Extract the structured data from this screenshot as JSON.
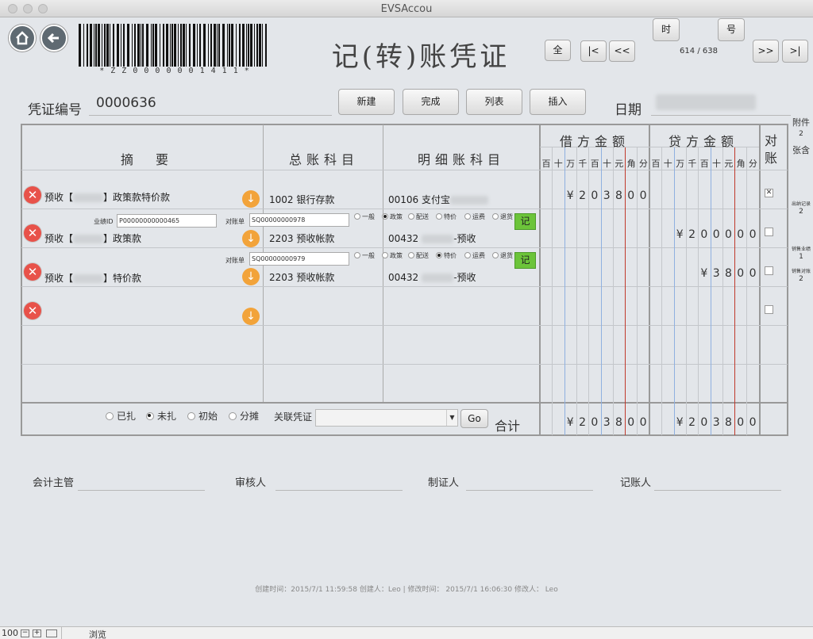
{
  "window": {
    "title": "EVSAccou"
  },
  "header": {
    "barcode_text": "* Z Z 0 0 0 0 0 0 1 4 1 1 *",
    "title": "记(转)账凭证",
    "btn_all": "全",
    "btn_first": "|<",
    "btn_prev": "<<",
    "btn_next": ">>",
    "btn_last": ">|",
    "btn_time": "时",
    "btn_number": "号",
    "record_counter": "614 / 638"
  },
  "voucher": {
    "number_label": "凭证编号",
    "number_value": "0000636",
    "date_label": "日期",
    "btn_new": "新建",
    "btn_done": "完成",
    "btn_list": "列表",
    "btn_insert": "插入"
  },
  "table": {
    "col_summary": "摘　要",
    "col_ledger": "总账科目",
    "col_detail": "明细账科目",
    "col_debit": "借方金额",
    "col_credit": "贷方金额",
    "col_reconcile": "对账",
    "digit_units": [
      "百",
      "十",
      "万",
      "千",
      "百",
      "十",
      "元",
      "角",
      "分"
    ],
    "rows": [
      {
        "summary_prefix": "预收【",
        "summary_suffix": "】政策款特价款",
        "ledger": "1002  银行存款",
        "detail_code": "00106  支付宝",
        "detail_suffix": "",
        "debit": "¥203800",
        "credit": "",
        "reconcile": "✕",
        "extra": {
          "perf_label": "业绩ID",
          "perf_value": "P00000000000465",
          "recon_label": "对账单",
          "recon_value": "SQ00000000978",
          "options": [
            "一般",
            "政策",
            "配送",
            "特价",
            "运费",
            "退货"
          ],
          "selected": 1,
          "btn": "记"
        }
      },
      {
        "summary_prefix": "预收【",
        "summary_suffix": "】政策款",
        "ledger": "2203  预收帐款",
        "detail_code": "00432",
        "detail_suffix": "-预收",
        "debit": "",
        "credit": "¥200000",
        "reconcile": "",
        "extra": {
          "recon_label": "对账单",
          "recon_value": "SQ00000000979",
          "options": [
            "一般",
            "政策",
            "配送",
            "特价",
            "运费",
            "退货"
          ],
          "selected": 3,
          "btn": "记"
        }
      },
      {
        "summary_prefix": "预收【",
        "summary_suffix": "】特价款",
        "ledger": "2203  预收帐款",
        "detail_code": "00432",
        "detail_suffix": "-预收",
        "debit": "",
        "credit": "¥3800",
        "reconcile": ""
      },
      {
        "summary_prefix": "",
        "summary_suffix": "",
        "ledger": "",
        "detail_code": "",
        "detail_suffix": "",
        "debit": "",
        "credit": "",
        "reconcile": ""
      }
    ],
    "status_options": [
      "已扎",
      "未扎",
      "初始",
      "分摊"
    ],
    "status_selected": 1,
    "linked_label": "关联凭证",
    "go_label": "Go",
    "total_label": "合计",
    "total_debit": "¥203800",
    "total_credit": "¥203800"
  },
  "side": {
    "attach_label": "附件",
    "attach_count": "2",
    "attach_unit": "张含",
    "outbound_label": "出纳记录",
    "outbound_count": "2",
    "sales_perf_label": "销售业绩",
    "sales_perf_count": "1",
    "sales_recon_label": "销售对账",
    "sales_recon_count": "2"
  },
  "signatures": {
    "accounting_supervisor": "会计主管",
    "reviewer": "审核人",
    "preparer": "制证人",
    "bookkeeper": "记账人"
  },
  "footer": {
    "meta": "创建时间：2015/7/1 11:59:58 创建人：Leo | 修改时间： 2015/7/1 16:06:30 修改人： Leo"
  },
  "statusbar": {
    "zoom": "100",
    "mode": "浏览"
  },
  "colors": {
    "delete_red": "#e8524a",
    "arrow_orange": "#f2a33a",
    "record_green": "#6cc43a",
    "red_line": "#c0392b",
    "blue_line": "#8fb0e0"
  }
}
